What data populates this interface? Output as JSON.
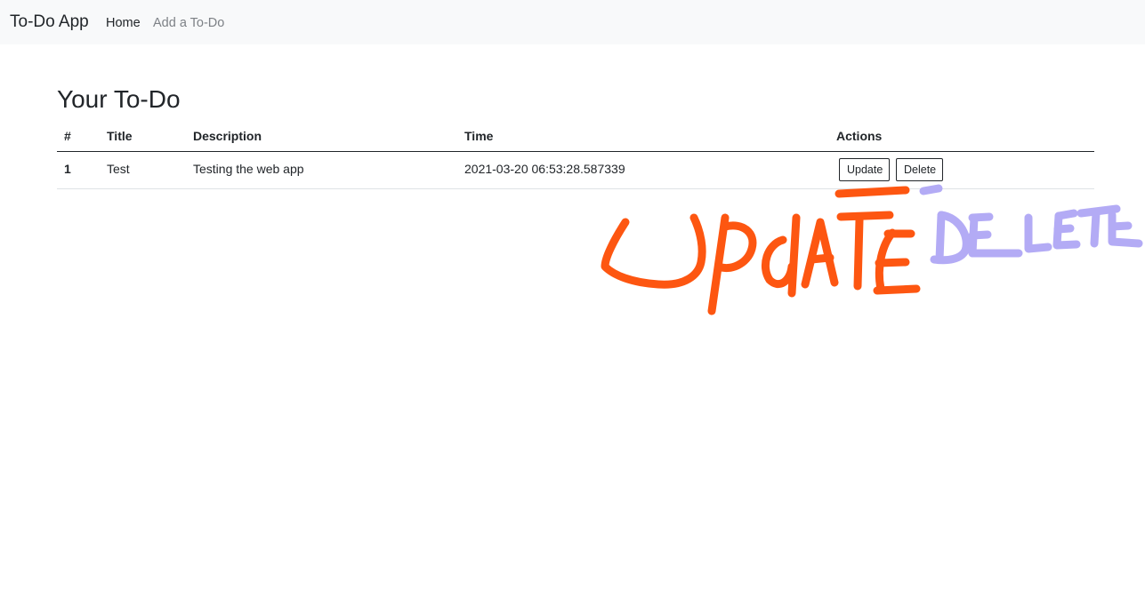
{
  "navbar": {
    "brand": "To-Do App",
    "links": [
      "Home",
      "Add a To-Do"
    ]
  },
  "page": {
    "title": "Your To-Do"
  },
  "table": {
    "headers": [
      "#",
      "Title",
      "Description",
      "Time",
      "Actions"
    ],
    "rows": [
      {
        "num": "1",
        "title": "Test",
        "description": "Testing the web app",
        "time": "2021-03-20 06:53:28.587339",
        "actions": [
          "Update",
          "Delete"
        ]
      }
    ]
  },
  "annotations": {
    "update_color": "#fd5611",
    "delete_color": "#b3abf5"
  },
  "colors": {
    "navbar_bg": "#f8f9fa",
    "muted_link": "#7d8186",
    "text": "#212529"
  }
}
